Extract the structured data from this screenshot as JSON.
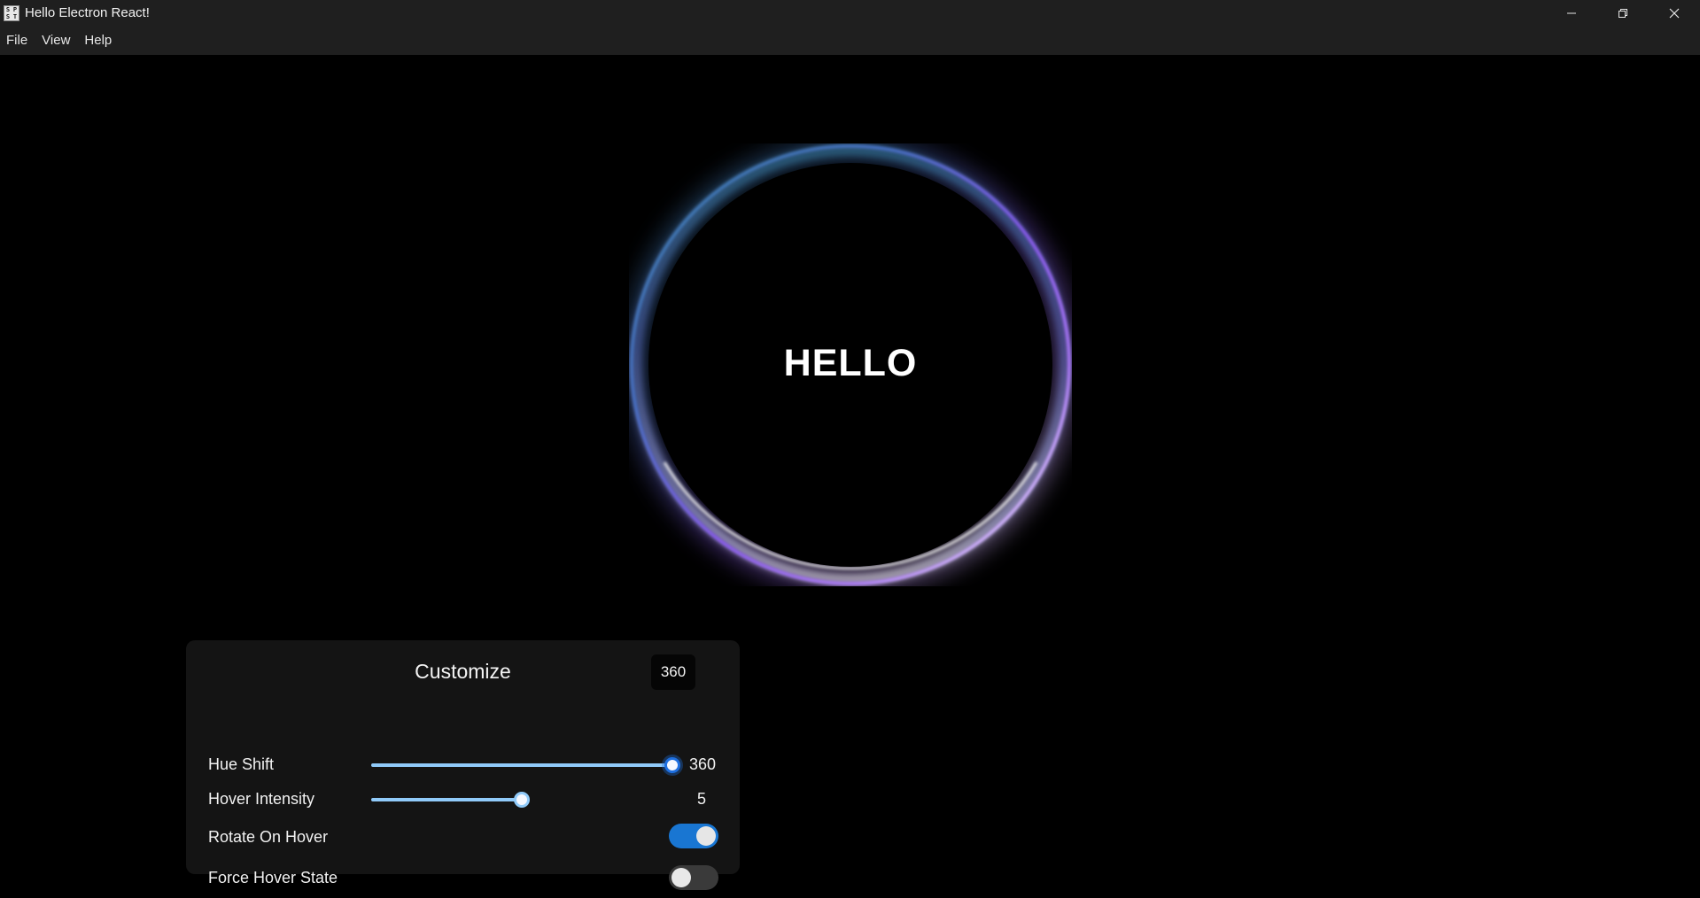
{
  "window": {
    "title": "Hello Electron React!",
    "icon": "app-icon",
    "icon_letters": [
      "S",
      "P",
      "S",
      "T"
    ],
    "controls": [
      "minimize-icon",
      "restore-icon",
      "close-icon"
    ]
  },
  "menu": {
    "items": [
      "File",
      "View",
      "Help"
    ]
  },
  "orb": {
    "text": "HELLO",
    "colors": {
      "top": "#4aa6c8",
      "right": "#9b5cf0",
      "bottom": "#ffffff",
      "left": "#a8b8ff"
    }
  },
  "customize": {
    "title": "Customize",
    "hue_shift": {
      "label": "Hue Shift",
      "value": "360",
      "tooltip": "360",
      "min": 0,
      "max": 360,
      "current": 360
    },
    "hover_intensity": {
      "label": "Hover Intensity",
      "value": "5",
      "fraction": 0.5
    },
    "rotate_on_hover": {
      "label": "Rotate On Hover",
      "checked": true
    },
    "force_hover_state": {
      "label": "Force Hover State",
      "checked": false
    }
  },
  "colors": {
    "background": "#000000",
    "titlebar": "#1f1f1f",
    "panel": "#141414",
    "accent": "#1976d2",
    "slider": "#90caf9"
  }
}
